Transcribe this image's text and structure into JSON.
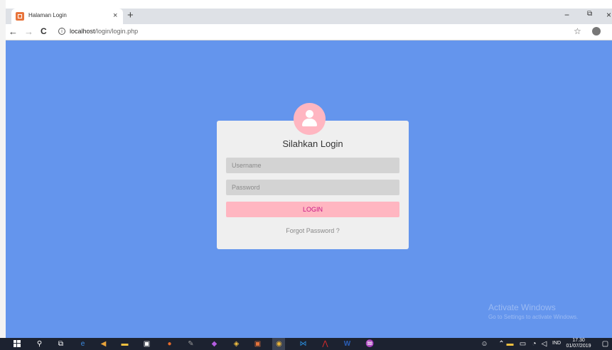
{
  "browser": {
    "tab": {
      "title": "Halaman Login",
      "close_symbol": "×"
    },
    "new_tab_symbol": "+",
    "window_controls": {
      "minimize": "−",
      "maximize": "⧉",
      "close": "×"
    },
    "nav": {
      "back": "←",
      "forward": "→",
      "reload": "C",
      "info": "i"
    },
    "address": {
      "host": "localhost",
      "path": "/login/login.php"
    },
    "star": "☆",
    "menu": "⋮"
  },
  "login": {
    "title": "Silahkan Login",
    "username_placeholder": "Username",
    "password_placeholder": "Password",
    "button_label": "LOGIN",
    "forgot_link": "Forgot Password ?"
  },
  "watermark": {
    "line1": "Activate Windows",
    "line2": "Go to Settings to activate Windows."
  },
  "taskbar": {
    "language": "IND",
    "time": "17.30",
    "date": "01/07/2019"
  },
  "colors": {
    "page_background": "#6495ed",
    "card_background": "#efefef",
    "accent_pink": "#ffb6c1",
    "button_text": "#c71585",
    "input_background": "#d3d3d3"
  }
}
